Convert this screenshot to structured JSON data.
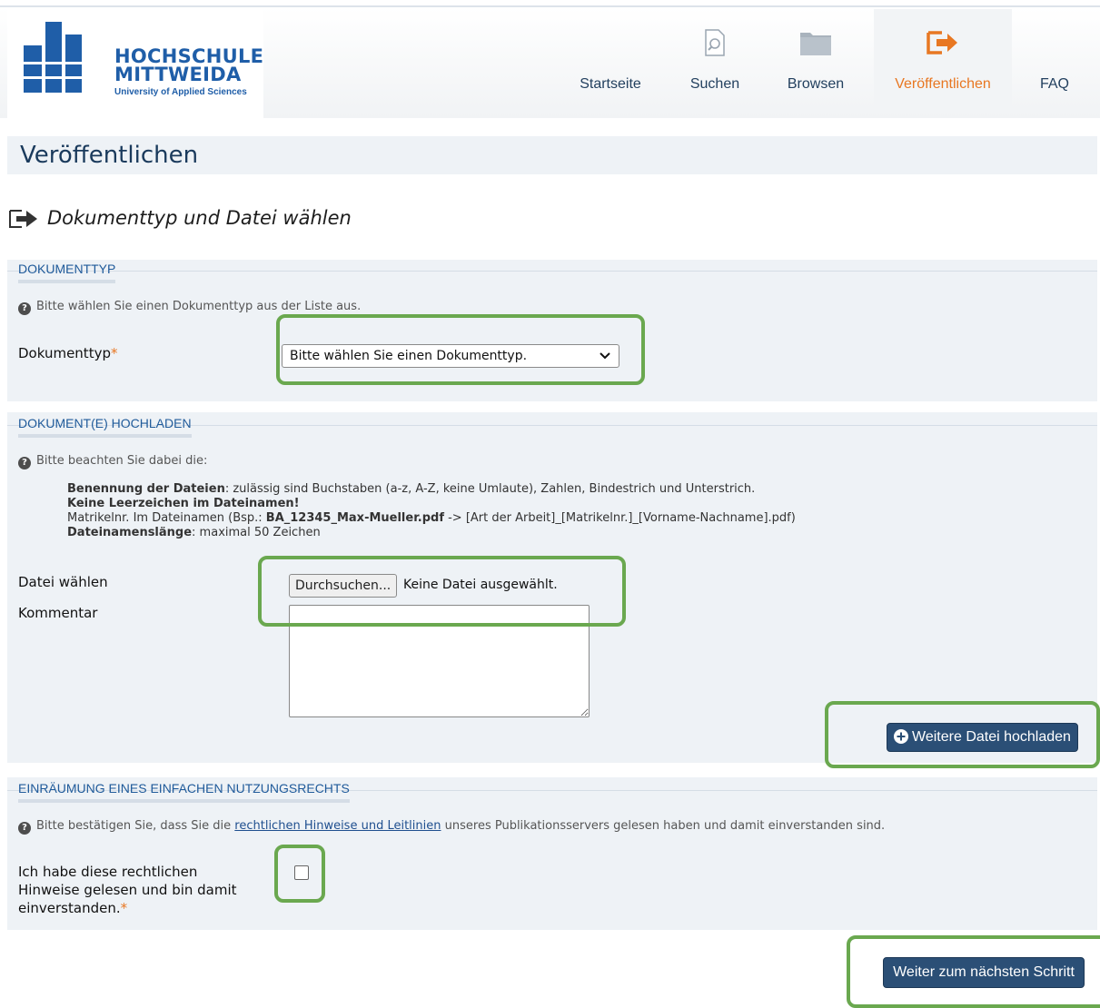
{
  "header": {
    "logo": {
      "line1": "HOCHSCHULE",
      "line2": "MITTWEIDA",
      "tagline": "University of Applied Sciences"
    },
    "nav": [
      {
        "label": "Startseite",
        "icon": "home"
      },
      {
        "label": "Suchen",
        "icon": "search-document-icon"
      },
      {
        "label": "Browsen",
        "icon": "folder-icon"
      },
      {
        "label": "Veröffentlichen",
        "icon": "publish-arrow-icon",
        "active": true
      },
      {
        "label": "FAQ",
        "icon": "faq"
      }
    ]
  },
  "page_title": "Veröffentlichen",
  "step_title": "Dokumenttyp und Datei wählen",
  "doctype_section": {
    "legend": "DOKUMENTTYP",
    "hint": "Bitte wählen Sie einen Dokumenttyp aus der Liste aus.",
    "field_label": "Dokumenttyp",
    "required_mark": "*",
    "select_value": "Bitte wählen Sie einen Dokumenttyp."
  },
  "upload_section": {
    "legend": "DOKUMENT(E) HOCHLADEN",
    "hint": "Bitte beachten Sie dabei die:",
    "rule1_bold": "Benennung der Dateien",
    "rule1_text": ": zulässig sind Buchstaben (a-z, A-Z, keine Umlaute), Zahlen, Bindestrich und Unterstrich.",
    "rule2_bold": "Keine Leerzeichen im Dateinamen!",
    "rule3_text_a": "Matrikelnr. Im Dateinamen (Bsp.: ",
    "rule3_bold": "BA_12345_Max-Mueller.pdf",
    "rule3_text_b": " -> [Art der Arbeit]_[Matrikelnr.]_[Vorname-Nachname].pdf)",
    "rule4_bold": "Dateinamenslänge",
    "rule4_text": ": maximal 50 Zeichen",
    "file_label": "Datei wählen",
    "browse_button": "Durchsuchen...",
    "file_status": "Keine Datei ausgewählt.",
    "comment_label": "Kommentar",
    "add_file_button": "Weitere Datei hochladen"
  },
  "rights_section": {
    "legend": "EINRÄUMUNG EINES EINFACHEN NUTZUNGSRECHTS",
    "hint_a": "Bitte bestätigen Sie, dass Sie die ",
    "hint_link": "rechtlichen Hinweise und Leitlinien",
    "hint_b": " unseres Publikationsservers gelesen haben und damit einverstanden sind.",
    "checkbox_label_1": "Ich habe diese rechtlichen",
    "checkbox_label_2": "Hinweise gelesen und bin damit",
    "checkbox_label_3": "einverstanden.",
    "required_mark": "*"
  },
  "next_button": "Weiter zum nächsten Schritt",
  "colors": {
    "brand_blue": "#1f5ea8",
    "accent_orange": "#e87722",
    "button_blue": "#2b4f76",
    "highlight_green": "#6aa84f",
    "panel_bg": "#eef2f6"
  }
}
